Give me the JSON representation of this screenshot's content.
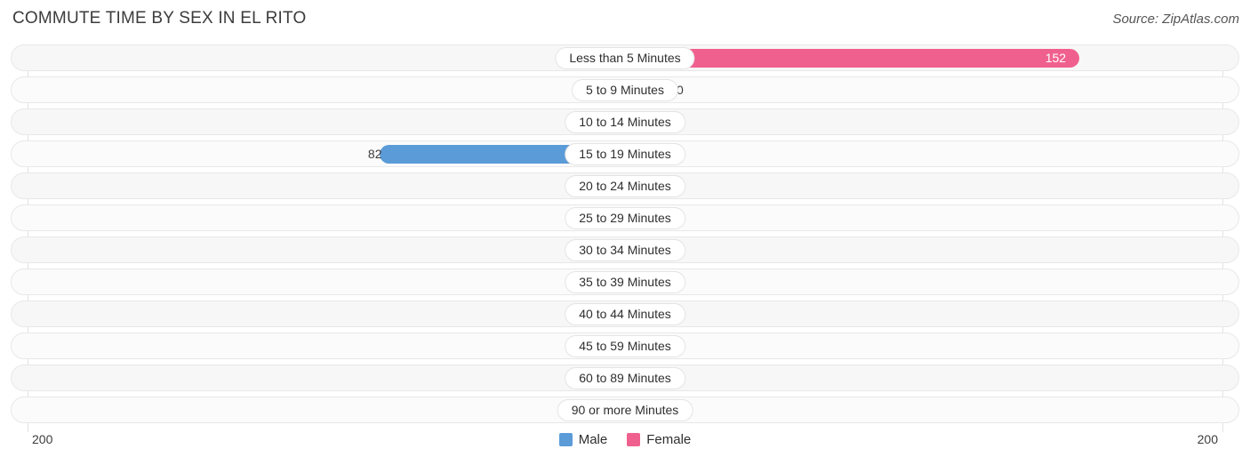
{
  "header": {
    "title": "COMMUTE TIME BY SEX IN EL RITO",
    "source": "Source: ZipAtlas.com"
  },
  "legend": {
    "male_label": "Male",
    "female_label": "Female",
    "male_color": "#5b9bd8",
    "female_color": "#f0608f"
  },
  "axis": {
    "left_tick": "200",
    "right_tick": "200",
    "max": 200
  },
  "chart_data": {
    "type": "bar",
    "title": "COMMUTE TIME BY SEX IN EL RITO",
    "orientation": "horizontal-diverging",
    "xlabel": "",
    "ylabel": "",
    "xlim": [
      200,
      200
    ],
    "grid": false,
    "legend_position": "bottom-center",
    "categories": [
      "Less than 5 Minutes",
      "5 to 9 Minutes",
      "10 to 14 Minutes",
      "15 to 19 Minutes",
      "20 to 24 Minutes",
      "25 to 29 Minutes",
      "30 to 34 Minutes",
      "35 to 39 Minutes",
      "40 to 44 Minutes",
      "45 to 59 Minutes",
      "60 to 89 Minutes",
      "90 or more Minutes"
    ],
    "series": [
      {
        "name": "Male",
        "color": "#5b9bd8",
        "values": [
          0,
          0,
          0,
          82,
          0,
          0,
          0,
          0,
          0,
          0,
          0,
          0
        ]
      },
      {
        "name": "Female",
        "color": "#f0608f",
        "values": [
          152,
          0,
          0,
          0,
          0,
          0,
          0,
          0,
          0,
          0,
          0,
          0
        ]
      }
    ],
    "labels": {
      "male": [
        "0",
        "0",
        "0",
        "82",
        "0",
        "0",
        "0",
        "0",
        "0",
        "0",
        "0",
        "0"
      ],
      "female": [
        "152",
        "0",
        "0",
        "0",
        "0",
        "0",
        "0",
        "0",
        "0",
        "0",
        "0",
        "0"
      ]
    }
  }
}
